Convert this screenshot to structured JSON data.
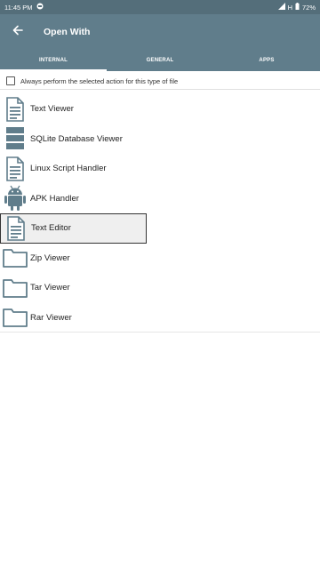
{
  "status_bar": {
    "time": "11:45 PM",
    "network": "H",
    "battery": "72%"
  },
  "app_bar": {
    "title": "Open With",
    "back_icon": "arrow-back-icon"
  },
  "tabs": [
    {
      "label": "INTERNAL",
      "active": true
    },
    {
      "label": "GENERAL",
      "active": false
    },
    {
      "label": "APPS",
      "active": false
    }
  ],
  "always_option": {
    "label": "Always perform the selected action for this type of file",
    "checked": false
  },
  "items": [
    {
      "label": "Text Viewer",
      "icon": "document-icon"
    },
    {
      "label": "SQLite Database Viewer",
      "icon": "database-icon"
    },
    {
      "label": "Linux Script Handler",
      "icon": "document-icon"
    },
    {
      "label": "APK Handler",
      "icon": "android-icon"
    },
    {
      "label": "Text Editor",
      "icon": "document-icon",
      "selected": true
    },
    {
      "label": "Zip Viewer",
      "icon": "folder-icon"
    },
    {
      "label": "Tar Viewer",
      "icon": "folder-icon"
    },
    {
      "label": "Rar Viewer",
      "icon": "folder-icon"
    }
  ],
  "colors": {
    "app_bar": "#607d8b",
    "status_bar": "#546e7a",
    "icon": "#607d8b"
  }
}
